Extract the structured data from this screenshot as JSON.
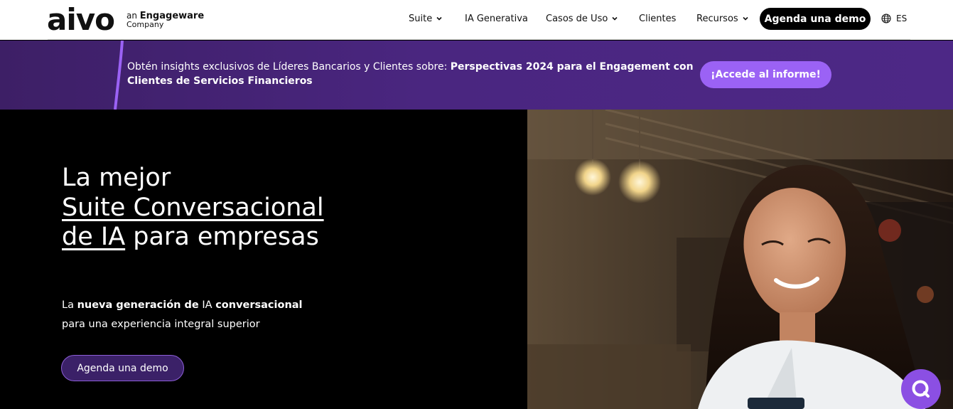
{
  "header": {
    "logo_text": "aivo",
    "tagline_prefix": "an",
    "tagline_brand": "Engageware",
    "tagline_suffix": "Company",
    "nav": [
      {
        "label": "Suite",
        "has_dropdown": true
      },
      {
        "label": "IA Generativa",
        "has_dropdown": false
      },
      {
        "label": "Casos de Uso",
        "has_dropdown": true
      },
      {
        "label": "Clientes",
        "has_dropdown": false
      },
      {
        "label": "Recursos",
        "has_dropdown": true
      }
    ],
    "demo_button": "Agenda una demo",
    "language": "ES"
  },
  "banner": {
    "text_plain": "Obtén insights exclusivos de Líderes Bancarios y Clientes sobre: ",
    "text_bold": "Perspectivas 2024 para el Engagement con Clientes de Servicios Financieros",
    "button": "¡Accede al informe!"
  },
  "hero": {
    "title_line1": "La mejor",
    "title_link": "Suite Conversacional de IA",
    "title_tail": " para empresas",
    "sub_1": "La ",
    "sub_2": "nueva generación de",
    "sub_3": " IA ",
    "sub_4": "conversacional",
    "sub_line2": "para una experiencia integral superior",
    "button": "Agenda una demo"
  },
  "colors": {
    "banner_bg": "#4a2680",
    "banner_button": "#9b62f5",
    "hero_button_bg": "#3b2168",
    "chat_fab": "#8b4fe3"
  }
}
